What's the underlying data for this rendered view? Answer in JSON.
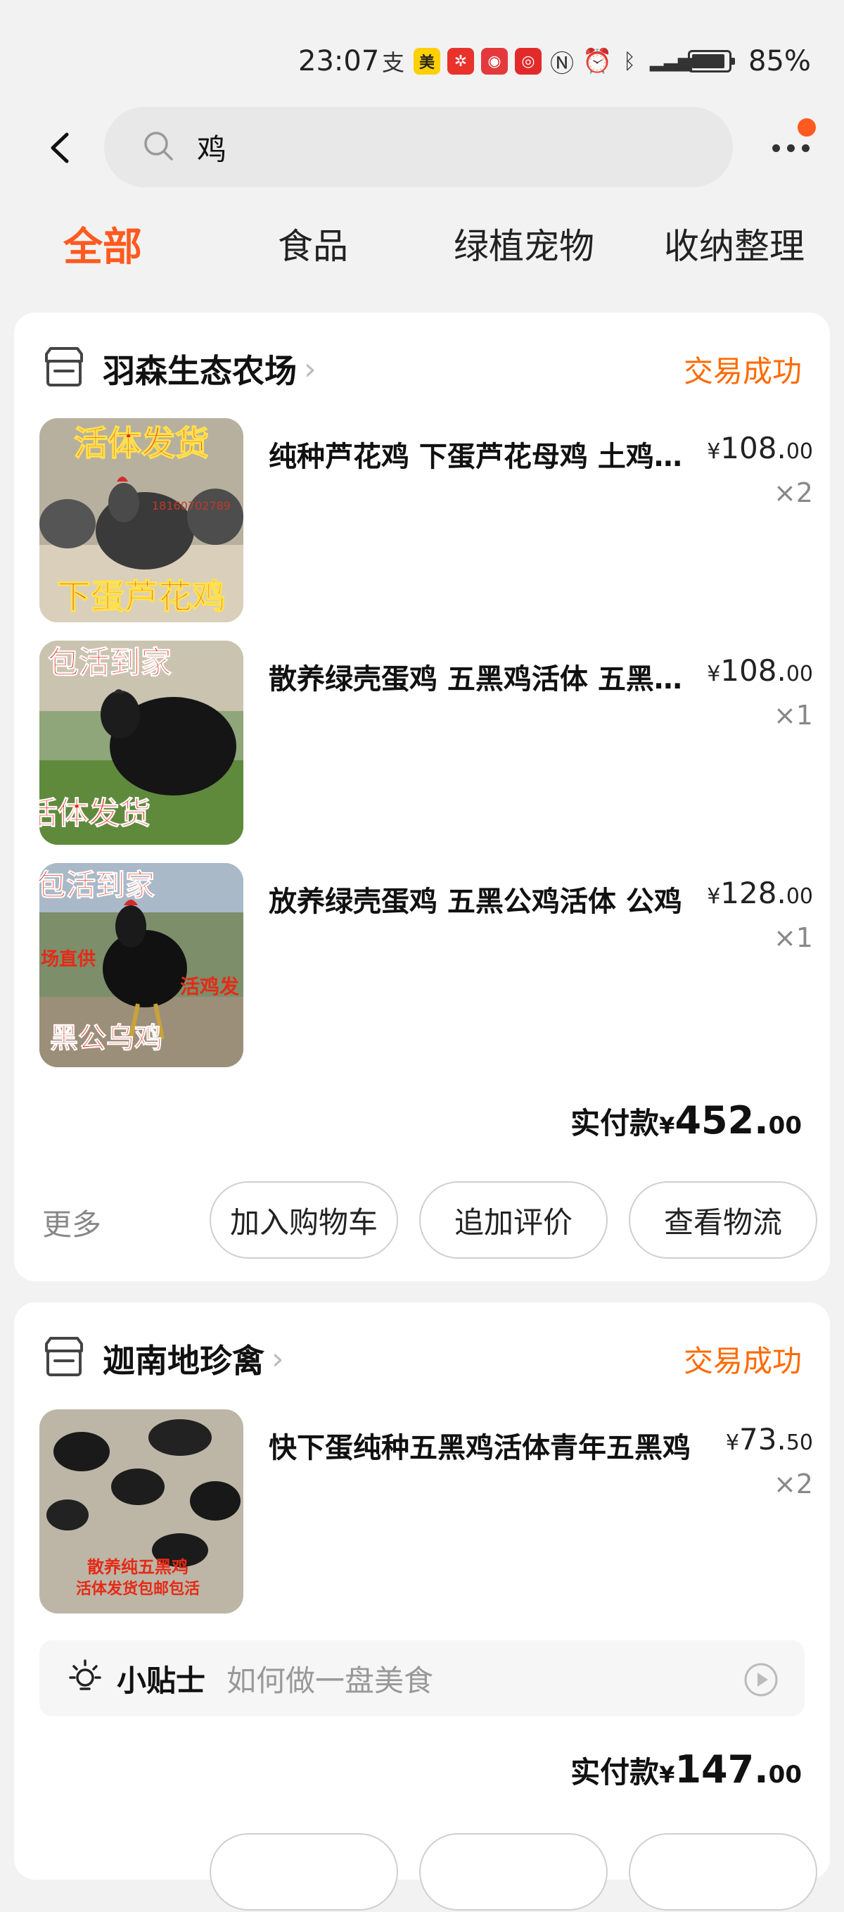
{
  "status_bar": {
    "time": "23:07",
    "battery_pct": "85%",
    "battery_level": 0.85,
    "app_icons": [
      {
        "name": "alipay-icon",
        "glyph": "支",
        "color": "#ffffff",
        "text": "#333333"
      },
      {
        "name": "meituan-icon",
        "glyph": "美",
        "color": "#ffd000",
        "text": "#222222"
      },
      {
        "name": "red-app-icon",
        "glyph": "✲",
        "color": "#e8322b",
        "text": "#ffffff"
      },
      {
        "name": "jd-app-icon",
        "glyph": "◉",
        "color": "#e4393c",
        "text": "#ffffff"
      },
      {
        "name": "sale-app-icon",
        "glyph": "◎",
        "color": "#e22a2a",
        "text": "#ffffff"
      }
    ],
    "system_icons": [
      "nfc-icon",
      "alarm-icon",
      "bluetooth-icon",
      "signal-icon"
    ]
  },
  "search": {
    "query": "鸡"
  },
  "tabs": [
    {
      "label": "全部",
      "active": true
    },
    {
      "label": "食品",
      "active": false
    },
    {
      "label": "绿植宠物",
      "active": false
    },
    {
      "label": "收纳整理",
      "active": false
    }
  ],
  "orders": [
    {
      "shop_name": "羽森生态农场",
      "status": "交易成功",
      "items": [
        {
          "title": "纯种芦花鸡 下蛋芦花母鸡 土鸡活体",
          "price_symbol": "¥",
          "price_int": "108.",
          "price_dec": "00",
          "qty": "×2",
          "image_text_top": "活体发货",
          "image_text_bottom": "下蛋芦花鸡",
          "image_text_phone": "18160702789"
        },
        {
          "title": "散养绿壳蛋鸡 五黑鸡活体 五黑母鸡",
          "price_symbol": "¥",
          "price_int": "108.",
          "price_dec": "00",
          "qty": "×1",
          "image_text_top": "包活到家",
          "image_text_bottom": "活体发货"
        },
        {
          "title": "放养绿壳蛋鸡 五黑公鸡活体 公鸡",
          "price_symbol": "¥",
          "price_int": "128.",
          "price_dec": "00",
          "qty": "×1",
          "image_text_top": "包活到家",
          "image_text_mid": "活鸡发",
          "image_text_left": "场直供",
          "image_text_bottom": "黑公乌鸡"
        }
      ],
      "total_label": "实付款",
      "total_symbol": "¥",
      "total_int": "452.",
      "total_dec": "00",
      "more_label": "更多",
      "actions": [
        "加入购物车",
        "追加评价",
        "查看物流"
      ]
    },
    {
      "shop_name": "迦南地珍禽",
      "status": "交易成功",
      "items": [
        {
          "title": "快下蛋纯种五黑鸡活体青年五黑鸡",
          "price_symbol": "¥",
          "price_int": "73.",
          "price_dec": "50",
          "qty": "×2",
          "image_text_line1": "散养纯五黑鸡",
          "image_text_line2": "活体发货包邮包活"
        }
      ],
      "tip": {
        "label": "小贴士",
        "text": "如何做一盘美食"
      },
      "total_label": "实付款",
      "total_symbol": "¥",
      "total_int": "147.",
      "total_dec": "00"
    }
  ],
  "colors": {
    "accent": "#ff5a1f",
    "status_orange": "#ff6a00",
    "background": "#f2f2f2"
  }
}
